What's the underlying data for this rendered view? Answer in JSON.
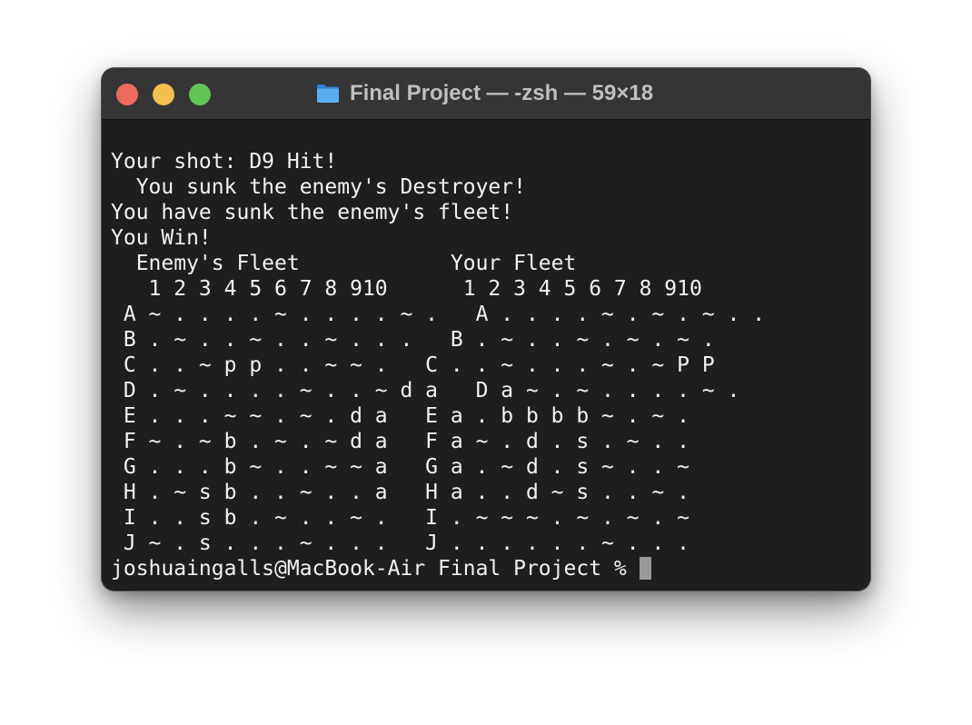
{
  "window": {
    "title": "Final Project — -zsh — 59×18",
    "title_icon": "folder-icon"
  },
  "terminal": {
    "lines": [
      "Your shot: D9 Hit!",
      "  You sunk the enemy's Destroyer!",
      "You have sunk the enemy's fleet!",
      "You Win!",
      "  Enemy's Fleet            Your Fleet",
      "   1 2 3 4 5 6 7 8 910      1 2 3 4 5 6 7 8 910",
      " A ~ . . . . ~ . . . . ~ .   A . . . . ~ . ~ . ~ . .",
      " B . ~ . . ~ . . ~ . . .   B . ~ . . ~ . ~ . ~ .",
      " C . . ~ p p . . ~ ~ .   C . . ~ . . . ~ . ~ P P",
      " D . ~ . . . . ~ . . ~ d a   D a ~ . ~ . . . . ~ .",
      " E . . . ~ ~ . ~ . d a   E a . b b b b ~ . ~ .",
      " F ~ . ~ b . ~ . ~ d a   F a ~ . d . s . ~ . .",
      " G . . . b ~ . . ~ ~ a   G a . ~ d . s ~ . . ~",
      " H . ~ s b . . ~ . . a   H a . . d ~ s . . ~ .",
      " I . . s b . ~ . . ~ .   I . ~ ~ ~ . ~ . ~ . ~",
      " J ~ . s . . . ~ . . .   J . . . . . . ~ . . ."
    ],
    "prompt": "joshuaingalls@MacBook-Air Final Project % "
  },
  "colors": {
    "background": "#1e1e1e",
    "titlebar": "#353535",
    "text": "#f2f2f2",
    "close": "#ed6a5e",
    "minimize": "#f5bf4f",
    "zoom": "#61c554",
    "folder": "#4a9fe6"
  }
}
